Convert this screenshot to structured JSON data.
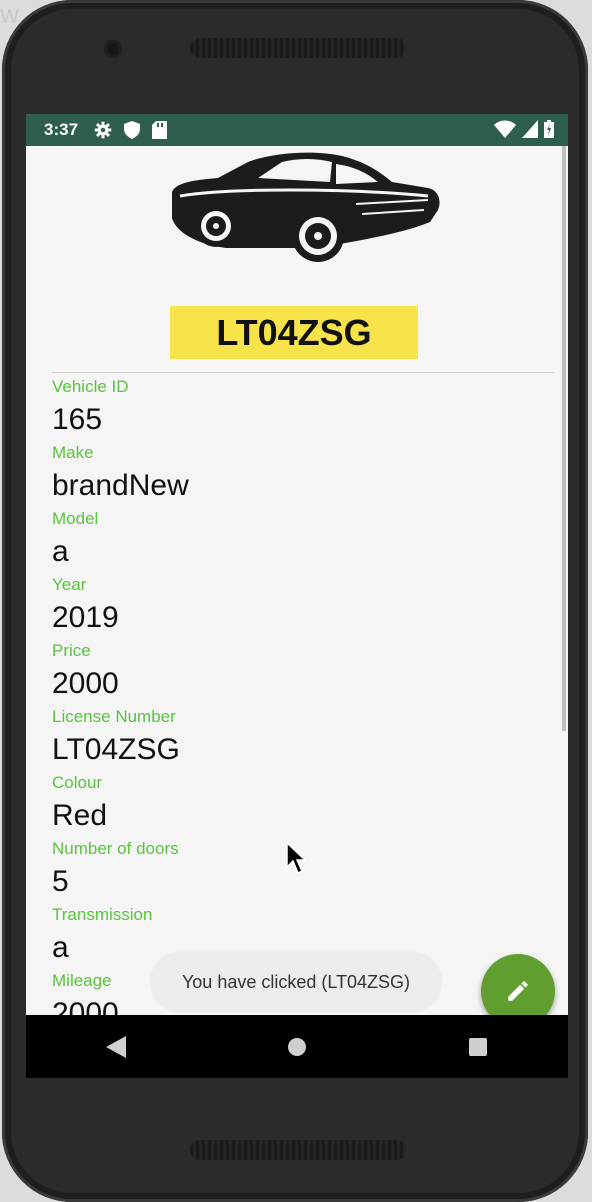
{
  "status_bar": {
    "time": "3:37",
    "icons": [
      "gear-icon",
      "shield-icon",
      "sd-card-icon",
      "wifi-icon",
      "signal-icon",
      "battery-icon"
    ],
    "color": "#2e5e4e"
  },
  "vehicle": {
    "plate": "LT04ZSG",
    "plate_color": "#f7e44b"
  },
  "fields": [
    {
      "label": "Vehicle ID",
      "value": "165"
    },
    {
      "label": "Make",
      "value": "brandNew"
    },
    {
      "label": "Model",
      "value": "a"
    },
    {
      "label": "Year",
      "value": "2019"
    },
    {
      "label": "Price",
      "value": "2000"
    },
    {
      "label": "License Number",
      "value": "LT04ZSG"
    },
    {
      "label": "Colour",
      "value": "Red"
    },
    {
      "label": "Number of doors",
      "value": "5"
    },
    {
      "label": "Transmission",
      "value": "a"
    },
    {
      "label": "Mileage",
      "value": "2000"
    }
  ],
  "toast": {
    "message": "You have clicked (LT04ZSG)"
  },
  "fab": {
    "icon": "edit-pencil-icon",
    "color": "#5f9e2f"
  },
  "label_color": "#59c43d",
  "navigation": {
    "back": "back-icon",
    "home": "home-icon",
    "recents": "recents-icon"
  }
}
